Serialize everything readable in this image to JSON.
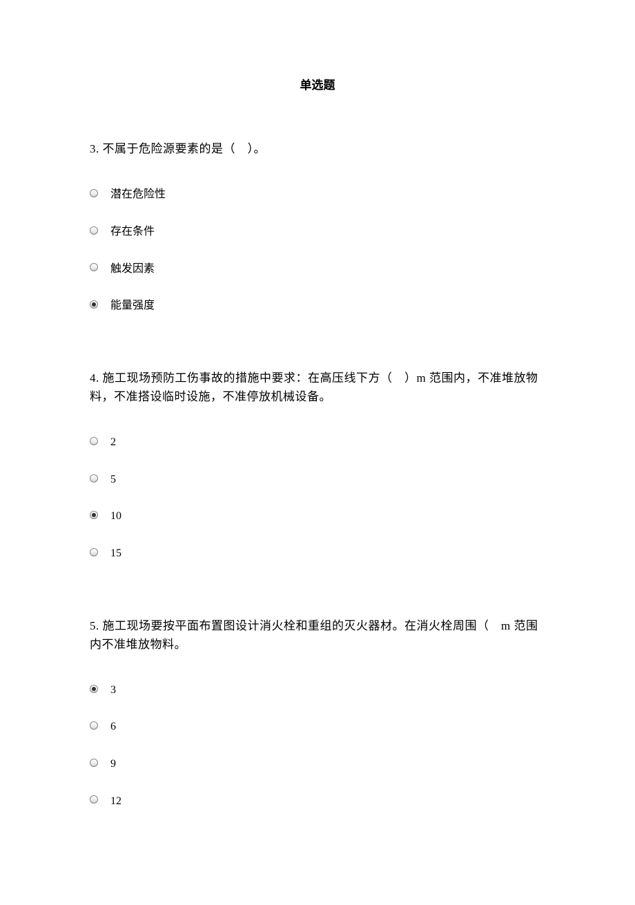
{
  "title": "单选题",
  "questions": [
    {
      "text": "3. 不属于危险源要素的是（　）。",
      "options": [
        {
          "label": "潜在危险性",
          "selected": false
        },
        {
          "label": "存在条件",
          "selected": false
        },
        {
          "label": "触发因素",
          "selected": false
        },
        {
          "label": "能量强度",
          "selected": true
        }
      ]
    },
    {
      "text": "4. 施工现场预防工伤事故的措施中要求：在高压线下方（　）m 范围内，不准堆放物料，不准搭设临时设施，不准停放机械设备。",
      "options": [
        {
          "label": "2",
          "selected": false
        },
        {
          "label": "5",
          "selected": false
        },
        {
          "label": "10",
          "selected": true
        },
        {
          "label": "15",
          "selected": false
        }
      ]
    },
    {
      "text": "5. 施工现场要按平面布置图设计消火栓和重组的灭火器材。在消火栓周围（　m 范围内不准堆放物料。",
      "options": [
        {
          "label": "3",
          "selected": true
        },
        {
          "label": "6",
          "selected": false
        },
        {
          "label": "9",
          "selected": false
        },
        {
          "label": "12",
          "selected": false
        }
      ]
    }
  ]
}
